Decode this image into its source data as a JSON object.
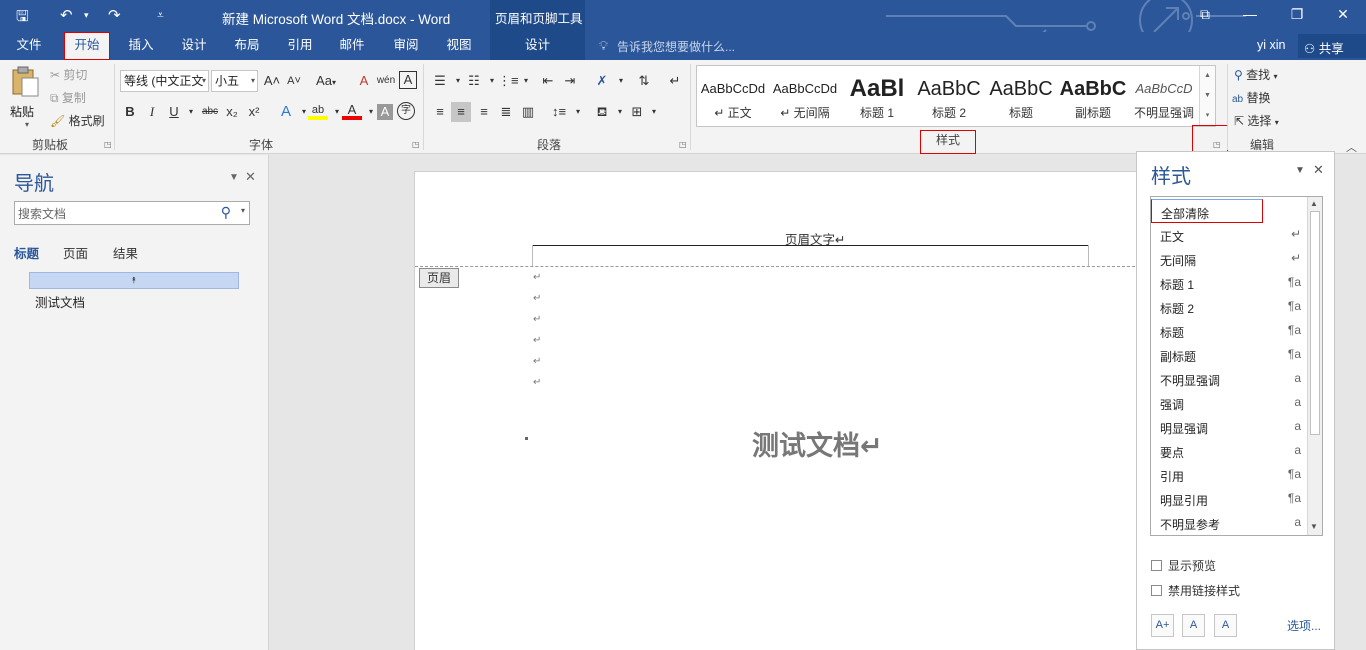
{
  "titlebar": {
    "title": "新建 Microsoft Word 文档.docx - Word",
    "context_group": "页眉和页脚工具",
    "quick_access": {
      "save": "🖫",
      "undo": "↶",
      "undo_arrow": "▾",
      "redo": "↷",
      "customize": "⩡"
    },
    "window": {
      "ribbon_options": "⧉",
      "minimize": "—",
      "restore": "❐",
      "close": "✕"
    }
  },
  "tabs": [
    {
      "label": "文件"
    },
    {
      "label": "开始"
    },
    {
      "label": "插入"
    },
    {
      "label": "设计"
    },
    {
      "label": "布局"
    },
    {
      "label": "引用"
    },
    {
      "label": "邮件"
    },
    {
      "label": "审阅"
    },
    {
      "label": "视图"
    },
    {
      "label": "设计"
    }
  ],
  "tell_me": "告诉我您想要做什么...",
  "user": "yi xin",
  "share": "共享",
  "ribbon": {
    "clipboard": {
      "label": "剪贴板",
      "paste": "粘贴",
      "cut": "剪切",
      "copy": "复制",
      "format_painter": "格式刷"
    },
    "font": {
      "label": "字体",
      "font_name": "等线 (中文正文",
      "font_size": "小五",
      "bold": "B",
      "italic": "I",
      "underline": "U",
      "strike": "abc",
      "sub": "x₂",
      "sup": "x²",
      "grow": "A˄",
      "shrink": "A˅",
      "change_case": "Aa",
      "clear": "A",
      "phonetic": "wén",
      "border_char": "A",
      "effects": "A",
      "highlight": "ab",
      "color": "A",
      "shading": "A",
      "enclose": "字"
    },
    "paragraph": {
      "label": "段落"
    },
    "styles": {
      "label": "样式",
      "gallery": [
        {
          "preview": "AaBbCcDd",
          "caption": "↵ 正文"
        },
        {
          "preview": "AaBbCcDd",
          "caption": "↵ 无间隔"
        },
        {
          "preview": "AaBl",
          "caption": "标题 1"
        },
        {
          "preview": "AaBbC",
          "caption": "标题 2"
        },
        {
          "preview": "AaBbC",
          "caption": "标题"
        },
        {
          "preview": "AaBbC",
          "caption": "副标题"
        },
        {
          "preview": "AaBbCcD",
          "caption": "不明显强调"
        }
      ]
    },
    "editing": {
      "label": "编辑",
      "find": "查找",
      "replace": "替换",
      "select": "选择"
    }
  },
  "nav": {
    "title": "导航",
    "search_placeholder": "搜索文档",
    "tabs": [
      "标题",
      "页面",
      "结果"
    ],
    "heading_item": "测试文档"
  },
  "doc": {
    "header_text": "页眉文字↵",
    "header_tag": "页眉",
    "para_mark": "↵",
    "title": "测试文档↵"
  },
  "styles_pane": {
    "title": "样式",
    "items": [
      {
        "name": "全部清除",
        "mark": ""
      },
      {
        "name": "正文",
        "mark": "↵"
      },
      {
        "name": "无间隔",
        "mark": "↵"
      },
      {
        "name": "标题 1",
        "mark": "¶a"
      },
      {
        "name": "标题 2",
        "mark": "¶a"
      },
      {
        "name": "标题",
        "mark": "¶a"
      },
      {
        "name": "副标题",
        "mark": "¶a"
      },
      {
        "name": "不明显强调",
        "mark": "a"
      },
      {
        "name": "强调",
        "mark": "a"
      },
      {
        "name": "明显强调",
        "mark": "a"
      },
      {
        "name": "要点",
        "mark": "a"
      },
      {
        "name": "引用",
        "mark": "¶a"
      },
      {
        "name": "明显引用",
        "mark": "¶a"
      },
      {
        "name": "不明显参考",
        "mark": "a"
      }
    ],
    "show_preview": "显示预览",
    "disable_linked": "禁用链接样式",
    "options": "选项...",
    "new_style": "A+",
    "inspector": "A",
    "manage": "A"
  },
  "colors": {
    "brand": "#2b579a",
    "highlight_red": "#d00000"
  }
}
